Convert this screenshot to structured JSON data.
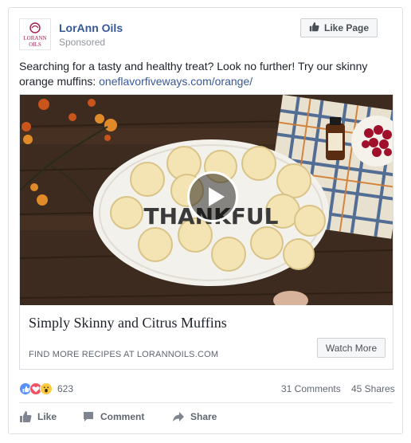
{
  "header": {
    "page_name": "LorAnn Oils",
    "sponsored": "Sponsored",
    "logo_text_top": "LORANN",
    "logo_text_bottom": "OILS",
    "like_page_label": "Like Page"
  },
  "post": {
    "text": "Searching for a tasty and healthy treat? Look no further! Try our skinny orange muffins: ",
    "link_text": "oneflavorfiveways.com/orange/"
  },
  "attachment": {
    "plate_text": "THANKFUL",
    "title": "Simply Skinny and Citrus Muffins",
    "domain": "FIND MORE RECIPES AT LORANNOILS.COM",
    "cta_label": "Watch More"
  },
  "stats": {
    "reaction_count": "623",
    "comments": "31 Comments",
    "shares": "45 Shares",
    "reaction_icons": [
      "like-reaction-icon",
      "love-reaction-icon",
      "wow-reaction-icon"
    ]
  },
  "actions": {
    "like": "Like",
    "comment": "Comment",
    "share": "Share"
  },
  "colors": {
    "link": "#365899",
    "like_blue": "#5890ff",
    "love_red": "#f25268",
    "wow_yellow": "#fcc93f"
  }
}
